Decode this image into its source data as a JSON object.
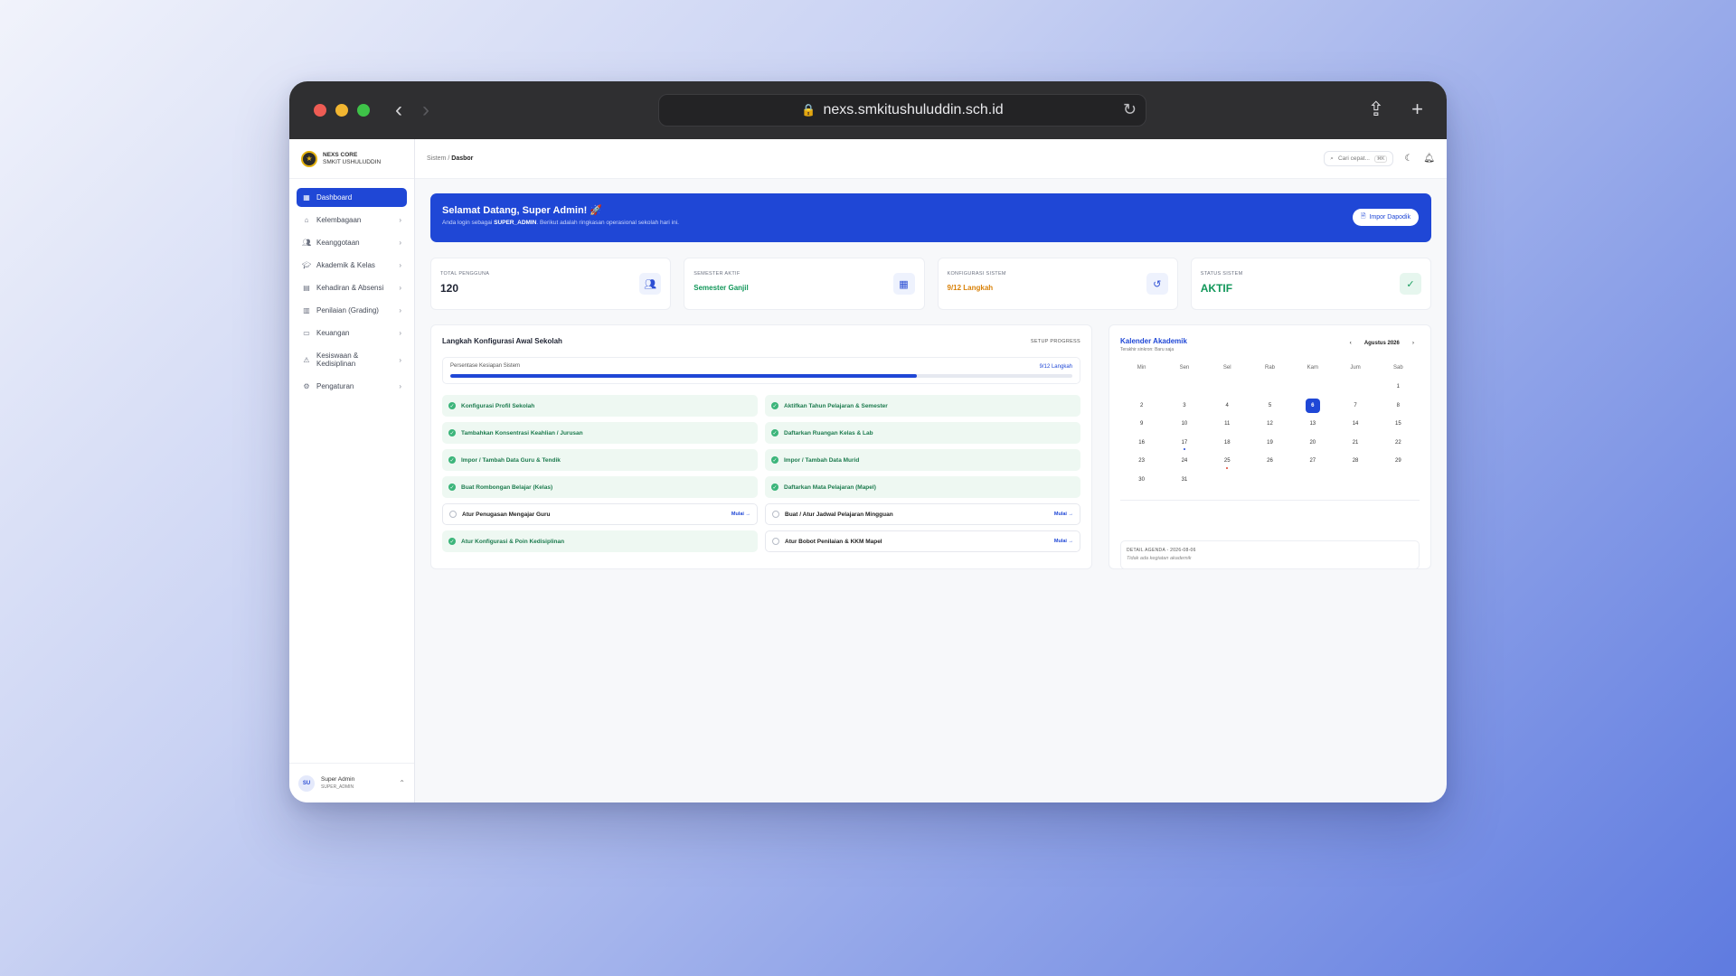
{
  "browser": {
    "url": "nexs.smkitushuluddin.sch.id"
  },
  "brand": {
    "name": "NEXS CORE",
    "school": "SMKIT USHULUDDIN"
  },
  "sidebar": {
    "items": [
      {
        "label": "Dashboard",
        "icon": "grid-icon",
        "active": true,
        "chevron": false
      },
      {
        "label": "Kelembagaan",
        "icon": "building-icon",
        "chevron": true
      },
      {
        "label": "Keanggotaan",
        "icon": "users-icon",
        "chevron": true
      },
      {
        "label": "Akademik & Kelas",
        "icon": "graduation-cap-icon",
        "chevron": true
      },
      {
        "label": "Kehadiran & Absensi",
        "icon": "clipboard-icon",
        "chevron": true
      },
      {
        "label": "Penilaian (Grading)",
        "icon": "clipboard-list-icon",
        "chevron": true
      },
      {
        "label": "Keuangan",
        "icon": "wallet-icon",
        "chevron": true
      },
      {
        "label": "Kesiswaan & Kedisiplinan",
        "icon": "alert-triangle-icon",
        "chevron": true
      },
      {
        "label": "Pengaturan",
        "icon": "gear-icon",
        "chevron": true
      }
    ]
  },
  "user": {
    "initials": "SU",
    "name": "Super Admin",
    "role": "SUPER_ADMIN"
  },
  "topbar": {
    "breadcrumb_root": "Sistem",
    "breadcrumb_sep": "/",
    "breadcrumb_current": "Dasbor",
    "search_placeholder": "Cari cepat...",
    "search_shortcut": "⌘K"
  },
  "banner": {
    "title": "Selamat Datang, Super Admin! 🚀",
    "subtitle_pre": "Anda login sebagai ",
    "subtitle_role": "SUPER_ADMIN",
    "subtitle_post": ". Berikut adalah ringkasan operasional sekolah hari ini.",
    "button": "Impor Dapodik"
  },
  "stats": [
    {
      "label": "TOTAL PENGGUNA",
      "value": "120",
      "icon": "users-icon",
      "color": "#1f2433"
    },
    {
      "label": "SEMESTER AKTIF",
      "value": "Semester Ganjil",
      "icon": "calendar-icon",
      "color": "#12975a"
    },
    {
      "label": "KONFIGURASI SISTEM",
      "value": "9/12 Langkah",
      "icon": "history-icon",
      "color": "#d9820a"
    },
    {
      "label": "STATUS SISTEM",
      "value": "AKTIF",
      "icon": "check-circle-icon",
      "color": "#12975a"
    }
  ],
  "setup": {
    "title": "Langkah Konfigurasi Awal Sekolah",
    "tag": "SETUP PROGRESS",
    "progress_label": "Persentase Kesiapan Sistem",
    "progress_count": "9/12 Langkah",
    "progress_fraction": 0.75,
    "start_label": "Mulai →",
    "steps": [
      {
        "label": "Konfigurasi Profil Sekolah",
        "done": true
      },
      {
        "label": "Aktifkan Tahun Pelajaran & Semester",
        "done": true
      },
      {
        "label": "Tambahkan Konsentrasi Keahlian / Jurusan",
        "done": true
      },
      {
        "label": "Daftarkan Ruangan Kelas & Lab",
        "done": true
      },
      {
        "label": "Impor / Tambah Data Guru & Tendik",
        "done": true
      },
      {
        "label": "Impor / Tambah Data Murid",
        "done": true
      },
      {
        "label": "Buat Rombongan Belajar (Kelas)",
        "done": true
      },
      {
        "label": "Daftarkan Mata Pelajaran (Mapel)",
        "done": true
      },
      {
        "label": "Atur Penugasan Mengajar Guru",
        "done": false
      },
      {
        "label": "Buat / Atur Jadwal Pelajaran Mingguan",
        "done": false
      },
      {
        "label": "Atur Konfigurasi & Poin Kedisiplinan",
        "done": true
      },
      {
        "label": "Atur Bobot Penilaian & KKM Mapel",
        "done": false
      }
    ]
  },
  "calendar": {
    "title": "Kalender Akademik",
    "sync_text": "Terakhir sinkron: Baru saja",
    "month": "Agustus 2026",
    "weekdays": [
      "Min",
      "Sen",
      "Sel",
      "Rab",
      "Kam",
      "Jum",
      "Sab"
    ],
    "first_weekday_index": 6,
    "days_in_month": 31,
    "today": 6,
    "event_days": [
      {
        "day": 17,
        "color": "#1f47d6"
      },
      {
        "day": 25,
        "color": "#e0412f"
      }
    ],
    "agenda_heading": "DETAIL AGENDA - 2026-08-06",
    "agenda_empty": "Tidak ada kegiatan akademik"
  }
}
